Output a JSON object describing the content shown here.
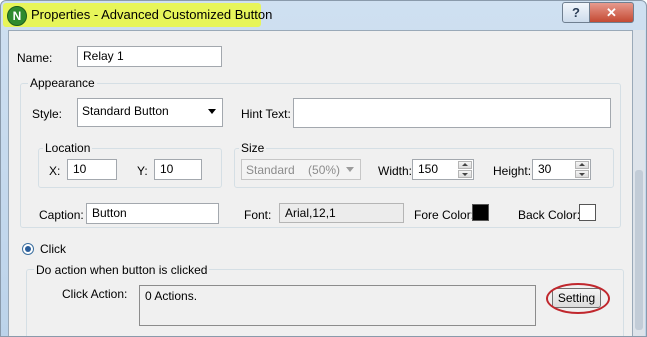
{
  "window": {
    "title": "Properties - Advanced Customized Button",
    "icon_letter": "N",
    "help_glyph": "?",
    "close_glyph": "✕"
  },
  "name": {
    "label": "Name:",
    "value": "Relay 1"
  },
  "appearance": {
    "title": "Appearance",
    "style_label": "Style:",
    "style_value": "Standard Button",
    "hint_label": "Hint Text:",
    "hint_value": "",
    "location": {
      "title": "Location",
      "x_label": "X:",
      "x_value": "10",
      "y_label": "Y:",
      "y_value": "10"
    },
    "size": {
      "title": "Size",
      "preset_value": "Standard    (50%)",
      "width_label": "Width:",
      "width_value": "150",
      "height_label": "Height:",
      "height_value": "30"
    },
    "caption_label": "Caption:",
    "caption_value": "Button",
    "font_label": "Font:",
    "font_value": "Arial,12,1",
    "fore_color_label": "Fore Color:",
    "fore_color": "#000000",
    "back_color_label": "Back Color:",
    "back_color": "#ffffff"
  },
  "click": {
    "radio_label": "Click",
    "selected": true,
    "group_title": "Do action when button is clicked",
    "action_label": "Click Action:",
    "action_value": "0 Actions.",
    "setting_button": "Setting"
  },
  "highlight_colors": {
    "title_highlight": "#e7f55a",
    "annotation_ring": "#c0272d"
  }
}
